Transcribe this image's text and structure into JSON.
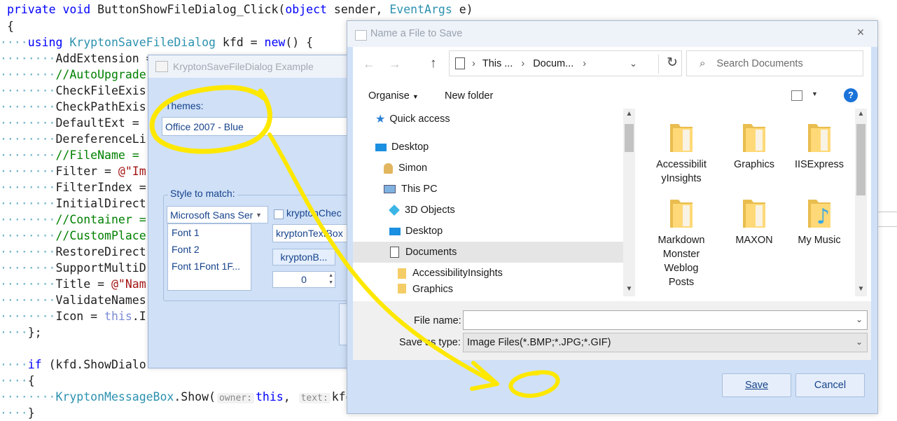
{
  "code": {
    "lines": [
      {
        "text1": "private void ",
        "text2": "ButtonShowFileDialog_Click(",
        "text3": "object",
        "text4": " sender, ",
        "text5": "EventArgs",
        "text6": " e)"
      },
      {
        "text1": "{"
      },
      {
        "text1": "using ",
        "text2": "KryptonSaveFileDialog",
        "text3": " kfd = ",
        "text4": "new",
        "text5": "() {"
      },
      {
        "text1": "AddExtension ="
      },
      {
        "text1": "//AutoUpgrade"
      },
      {
        "text1": "CheckFileExis"
      },
      {
        "text1": "CheckPathExis"
      },
      {
        "text1": "DefaultExt = "
      },
      {
        "text1": "DereferenceLi"
      },
      {
        "text1": "//FileName = "
      },
      {
        "text1": "Filter = ",
        "text2": "@\"Im"
      },
      {
        "text1": "FilterIndex ="
      },
      {
        "text1": "InitialDirect"
      },
      {
        "text1": "//Container ="
      },
      {
        "text1": "//CustomPlace"
      },
      {
        "text1": "RestoreDirect"
      },
      {
        "text1": "SupportMultiD"
      },
      {
        "text1": "Title = ",
        "text2": "@\"Nam"
      },
      {
        "text1": "ValidateNames"
      },
      {
        "text1": "Icon = ",
        "text2": "this",
        "text3": ".I"
      },
      {
        "text1": "};"
      },
      {
        "text1": ""
      },
      {
        "text1": "if ",
        "text2": "(kfd.",
        "text3": "ShowDialo"
      },
      {
        "text1": "{"
      },
      {
        "text1": "KryptonMessageBox",
        "text2": ".Show(",
        "hint1": "owner:",
        "text3": "this",
        "text4": ", ",
        "hint2": "text:",
        "text5": "kfd"
      },
      {
        "text1": "}"
      }
    ]
  },
  "example_dialog": {
    "title": "KryptonSaveFileDialog Example",
    "themes_label": "Themes:",
    "theme_value": "Office 2007 - Blue",
    "style_group_label": "Style to match:",
    "font_combo": "Microsoft Sans Ser",
    "font_list": [
      "Font 1",
      "Font 2",
      "Font 1Font 1F..."
    ],
    "checkbox_label": "kryptonChec",
    "textbox_value": "kryptonTextBox",
    "button_label": "kryptonB...",
    "numeric_value": "0"
  },
  "save_dialog": {
    "title": "Name a File to Save",
    "close_glyph": "×",
    "breadcrumb": [
      "This ...",
      "Docum..."
    ],
    "search_placeholder": "Search Documents",
    "organise_label": "Organise",
    "new_folder_label": "New folder",
    "nav_items": [
      {
        "label": "Quick access",
        "icon": "star-icon"
      },
      {
        "label": "Desktop",
        "icon": "desktop-icon"
      },
      {
        "label": "Simon",
        "icon": "user-icon"
      },
      {
        "label": "This PC",
        "icon": "computer-icon"
      },
      {
        "label": "3D Objects",
        "icon": "cube-icon"
      },
      {
        "label": "Desktop",
        "icon": "desktop-icon"
      },
      {
        "label": "Documents",
        "icon": "document-icon",
        "selected": true
      },
      {
        "label": "AccessibilityInsights",
        "icon": "folder-icon"
      },
      {
        "label": "Graphics",
        "icon": "folder-icon"
      }
    ],
    "folders": [
      {
        "name": "Accessibilit\nyInsights"
      },
      {
        "name": "Graphics"
      },
      {
        "name": "IISExpress"
      },
      {
        "name": "Markdown\nMonster\nWeblog\nPosts"
      },
      {
        "name": "MAXON"
      },
      {
        "name": "My Music"
      }
    ],
    "file_name_label": "File name:",
    "file_name_value": "",
    "save_as_type_label": "Save as type:",
    "save_as_type_value": "Image Files(*.BMP;*.JPG;*.GIF)",
    "save_button": "Save",
    "cancel_button": "Cancel",
    "help_glyph": "?"
  },
  "colors": {
    "krypton_blue": "#cfe0f7",
    "annotation_yellow": "#ffe800",
    "help_blue": "#1a73d9"
  }
}
